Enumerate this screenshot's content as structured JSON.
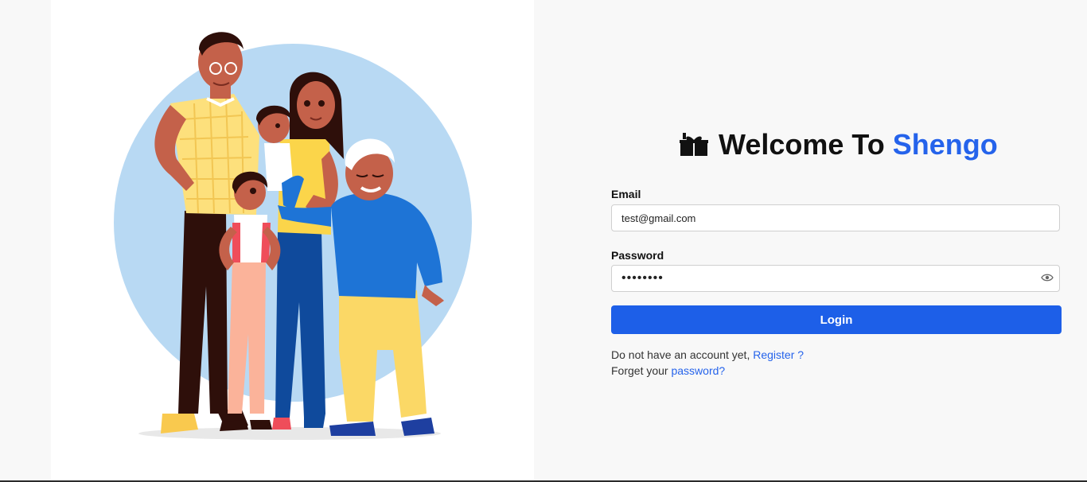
{
  "header": {
    "gift_icon": "gift-icon",
    "title_prefix": "Welcome To",
    "brand": "Shengo",
    "brand_color": "#2563eb"
  },
  "form": {
    "email_label": "Email",
    "email_value": "test@gmail.com",
    "password_label": "Password",
    "password_value": "password",
    "password_toggle_icon": "eye-icon",
    "login_label": "Login",
    "login_color": "#1d5fe8"
  },
  "links": {
    "register_prompt": "Do not have an account yet,",
    "register_link": "Register ?",
    "forgot_prompt": "Forget your",
    "forgot_link": "password?"
  },
  "illustration": {
    "description_icon": "family-illustration"
  }
}
